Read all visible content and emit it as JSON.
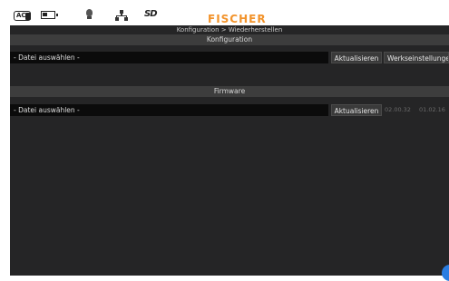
{
  "statusbar": {
    "ac_label": "AC",
    "sd_label": "SD",
    "brand": "FISCHER"
  },
  "header": {
    "breadcrumb": "Konfiguration > Wiederherstellen"
  },
  "configuration": {
    "title": "Konfiguration",
    "file_placeholder": "- Datei auswählen -",
    "refresh_label": "Aktualisieren",
    "factory_label": "Werkseinstellungen"
  },
  "firmware": {
    "title": "Firmware",
    "file_placeholder": "- Datei auswählen -",
    "refresh_label": "Aktualisieren",
    "version_1": "02.00.32",
    "version_2": "01.02.16"
  }
}
